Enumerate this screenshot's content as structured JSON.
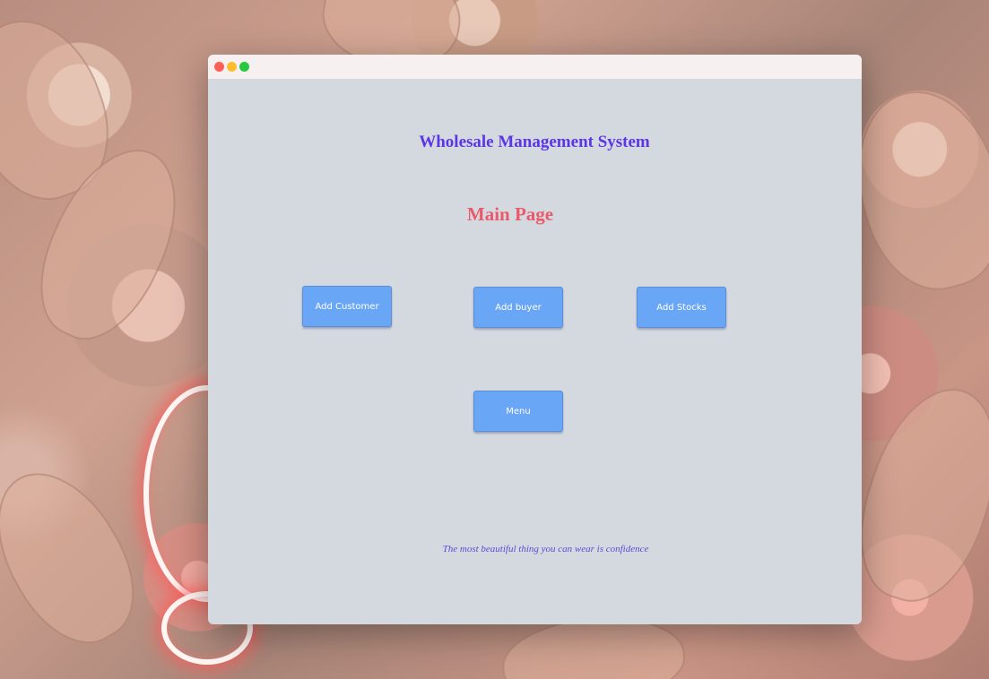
{
  "window": {
    "controls": {
      "close_icon": "close-dot",
      "minimize_icon": "minimize-dot",
      "maximize_icon": "maximize-dot"
    }
  },
  "app": {
    "title": "Wholesale Management System",
    "page_title": "Main Page",
    "tagline": "The most beautiful thing you can wear is confidence"
  },
  "buttons": {
    "add_customer": "Add Customer",
    "add_buyer": "Add buyer",
    "add_stocks": "Add Stocks",
    "menu": "Menu"
  },
  "colors": {
    "title": "#5b36e6",
    "page_title": "#ea5a6a",
    "button_bg": "#6aa6f6",
    "window_bg": "#d4d9e0",
    "tagline": "#5a4ed6"
  }
}
